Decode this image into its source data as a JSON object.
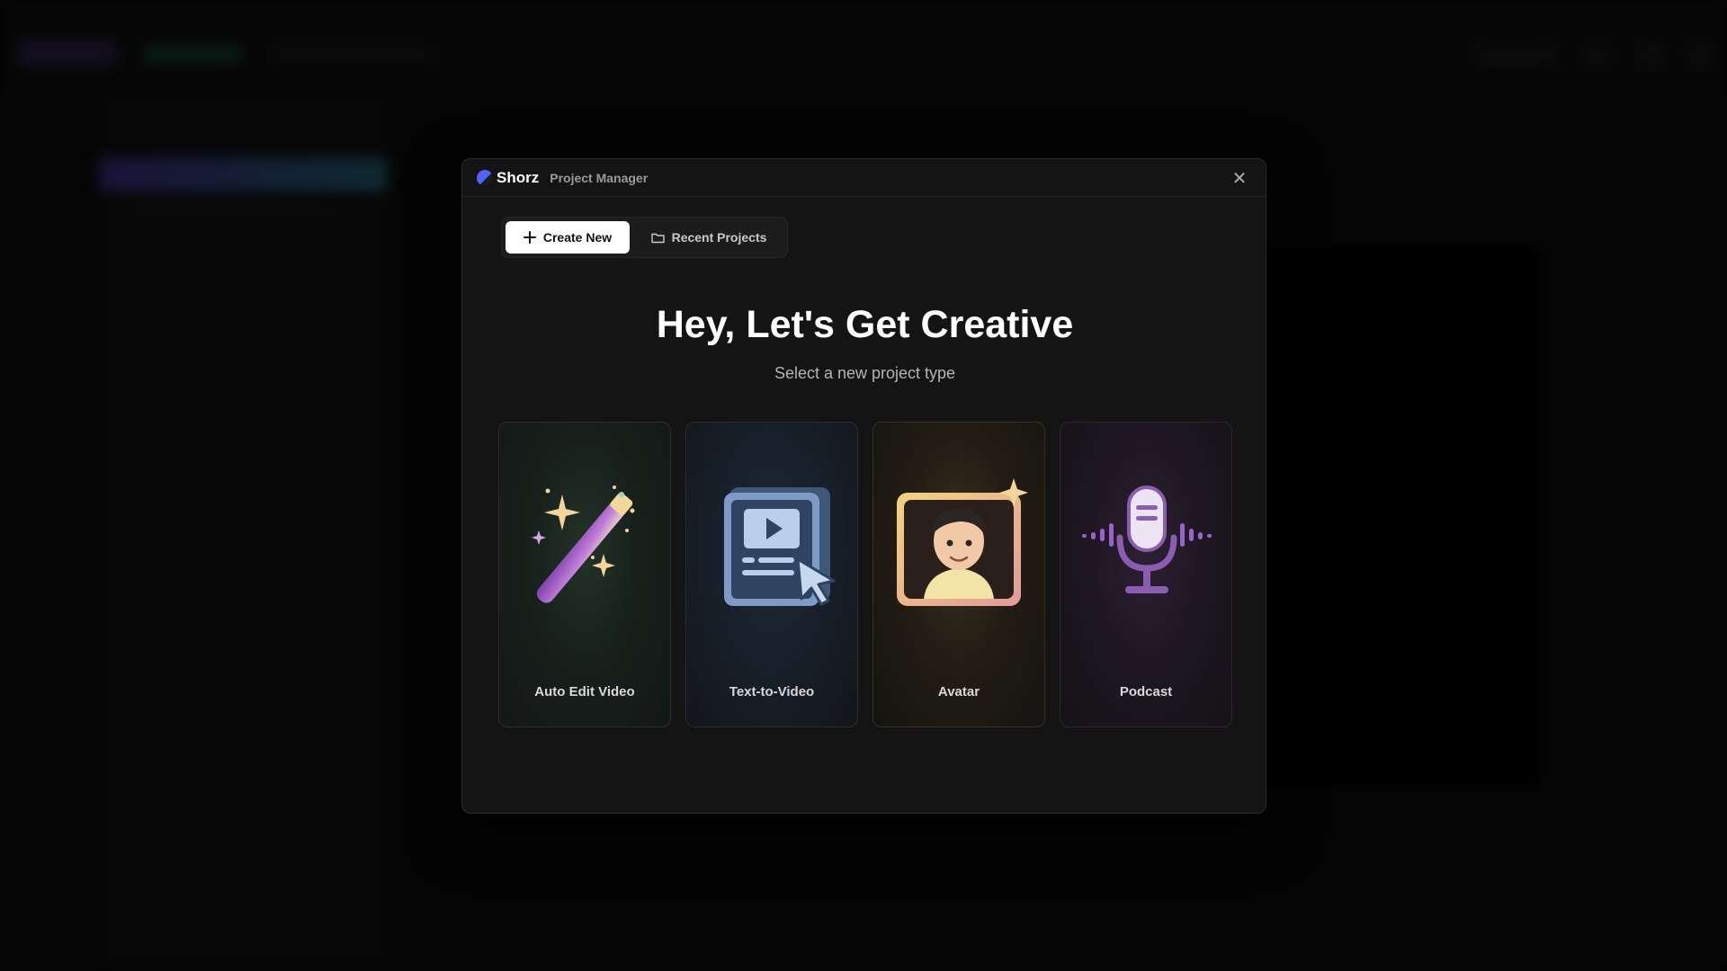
{
  "header": {
    "brand": "Shorz",
    "title": "Project Manager",
    "close_glyph": "✕"
  },
  "tabs": [
    {
      "label": "Create New",
      "icon": "plus-icon",
      "active": true
    },
    {
      "label": "Recent Projects",
      "icon": "folder-icon",
      "active": false
    }
  ],
  "hero": {
    "title": "Hey, Let's Get Creative",
    "subtitle": "Select a new project type"
  },
  "cards": [
    {
      "label": "Auto Edit Video",
      "icon": "magic-wand-icon"
    },
    {
      "label": "Text-to-Video",
      "icon": "video-document-icon"
    },
    {
      "label": "Avatar",
      "icon": "avatar-portrait-icon"
    },
    {
      "label": "Podcast",
      "icon": "microphone-icon"
    }
  ],
  "colors": {
    "modal_bg": "#141414",
    "accent": "#7c4dff",
    "active_tab": "#ffffff"
  }
}
